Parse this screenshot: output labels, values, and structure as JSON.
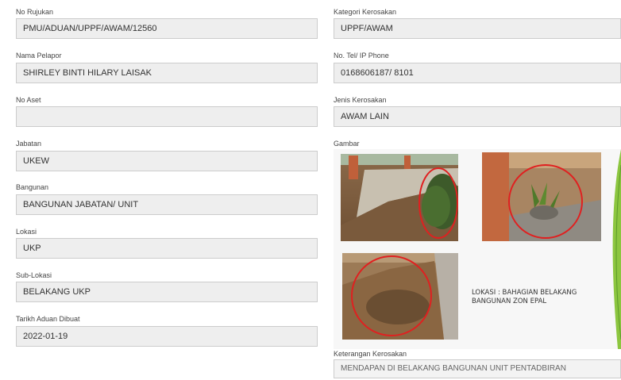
{
  "left": {
    "no_rujukan": {
      "label": "No Rujukan",
      "value": "PMU/ADUAN/UPPF/AWAM/12560"
    },
    "nama_pelapor": {
      "label": "Nama Pelapor",
      "value": "SHIRLEY BINTI HILARY LAISAK"
    },
    "no_aset": {
      "label": "No Aset",
      "value": ""
    },
    "jabatan": {
      "label": "Jabatan",
      "value": "UKEW"
    },
    "bangunan": {
      "label": "Bangunan",
      "value": "BANGUNAN JABATAN/ UNIT"
    },
    "lokasi": {
      "label": "Lokasi",
      "value": "UKP"
    },
    "sub_lokasi": {
      "label": "Sub-Lokasi",
      "value": "BELAKANG UKP"
    },
    "tarikh": {
      "label": "Tarikh Aduan Dibuat",
      "value": "2022-01-19"
    }
  },
  "right": {
    "kategori": {
      "label": "Kategori Kerosakan",
      "value": "UPPF/AWAM"
    },
    "no_tel": {
      "label": "No. Tel/ IP Phone",
      "value": "0168606187/ 8101"
    },
    "jenis": {
      "label": "Jenis Kerosakan",
      "value": "AWAM LAIN"
    },
    "gambar": {
      "label": "Gambar",
      "caption_line1": "LOKASI : BAHAGIAN BELAKANG",
      "caption_line2": "BANGUNAN ZON EPAL"
    },
    "keterangan": {
      "label": "Keterangan Kerosakan",
      "value": "MENDAPAN DI BELAKANG BANGUNAN UNIT PENTADBIRAN"
    }
  },
  "colors": {
    "field_bg": "#eeeeee",
    "field_border": "#cccccc",
    "circle": "#e02020"
  }
}
